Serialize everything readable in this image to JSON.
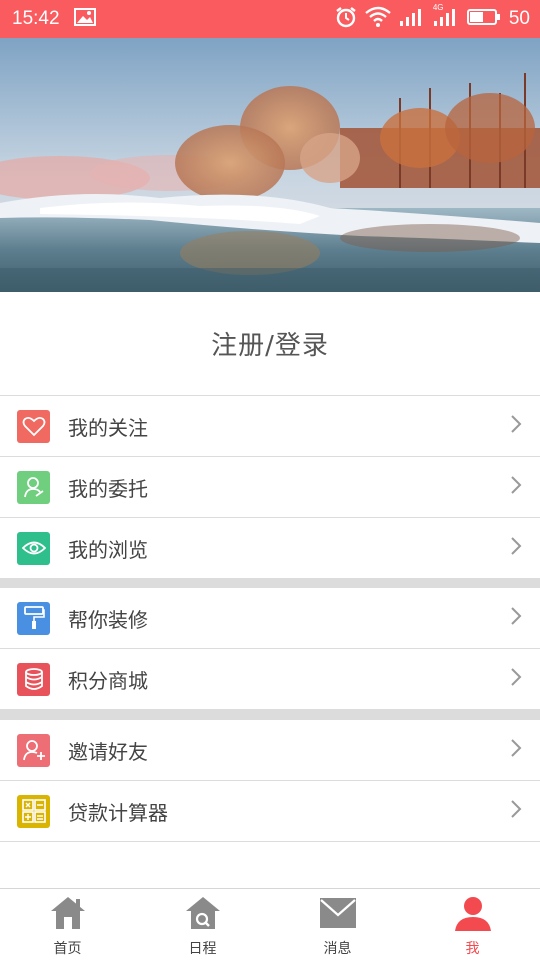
{
  "status_bar": {
    "time": "15:42",
    "battery": "50",
    "network": "4G"
  },
  "login": {
    "label": "注册/登录"
  },
  "menu_groups": [
    {
      "items": [
        {
          "label": "我的关注",
          "icon": "heart-icon",
          "color": "#f06a62"
        },
        {
          "label": "我的委托",
          "icon": "person-icon",
          "color": "#6fcf7f"
        },
        {
          "label": "我的浏览",
          "icon": "eye-icon",
          "color": "#2fbf8c"
        }
      ]
    },
    {
      "items": [
        {
          "label": "帮你装修",
          "icon": "paint-roller-icon",
          "color": "#4a90e2"
        },
        {
          "label": "积分商城",
          "icon": "coins-icon",
          "color": "#e8525a"
        }
      ]
    },
    {
      "items": [
        {
          "label": "邀请好友",
          "icon": "add-friend-icon",
          "color": "#ee6e75"
        },
        {
          "label": "贷款计算器",
          "icon": "calculator-icon",
          "color": "#d9b400"
        }
      ]
    }
  ],
  "tab_bar": {
    "tabs": [
      {
        "label": "首页",
        "icon": "home-icon"
      },
      {
        "label": "日程",
        "icon": "home-search-icon"
      },
      {
        "label": "消息",
        "icon": "mail-icon"
      },
      {
        "label": "我",
        "icon": "user-icon",
        "active": true
      }
    ]
  },
  "colors": {
    "accent": "#f95b5f",
    "separator": "#dcdcdc"
  }
}
